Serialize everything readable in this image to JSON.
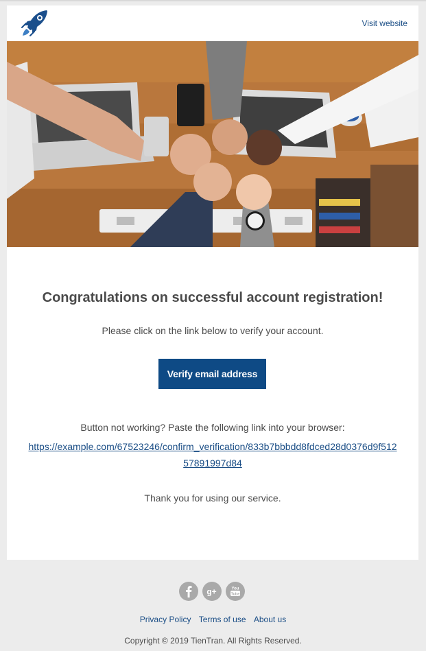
{
  "header": {
    "logo_icon": "rocket-icon",
    "visit_label": "Visit website"
  },
  "hero": {
    "image_icon": "team-fist-bump-photo"
  },
  "content": {
    "title": "Congratulations on successful account registration!",
    "intro": "Please click on the link below to verify your account.",
    "button_label": "Verify email address",
    "fallback_text": "Button not working? Paste the following link into your browser:",
    "verify_url": "https://example.com/67523246/confirm_verification/833b7bbbdd8fdced28d0376d9f51257891997d84",
    "thanks": "Thank you for using our service."
  },
  "footer": {
    "social": [
      "facebook-icon",
      "google-plus-icon",
      "youtube-icon"
    ],
    "links": {
      "privacy": "Privacy Policy",
      "terms": "Terms of use",
      "about": "About us"
    },
    "copyright": "Copyright © 2019 TienTran. All Rights Reserved."
  },
  "colors": {
    "background": "#ececec",
    "card": "#ffffff",
    "accent": "#0e4a85",
    "link": "#1b4e86",
    "text": "#4a4a4a",
    "social_icon": "#a9a9a9"
  }
}
